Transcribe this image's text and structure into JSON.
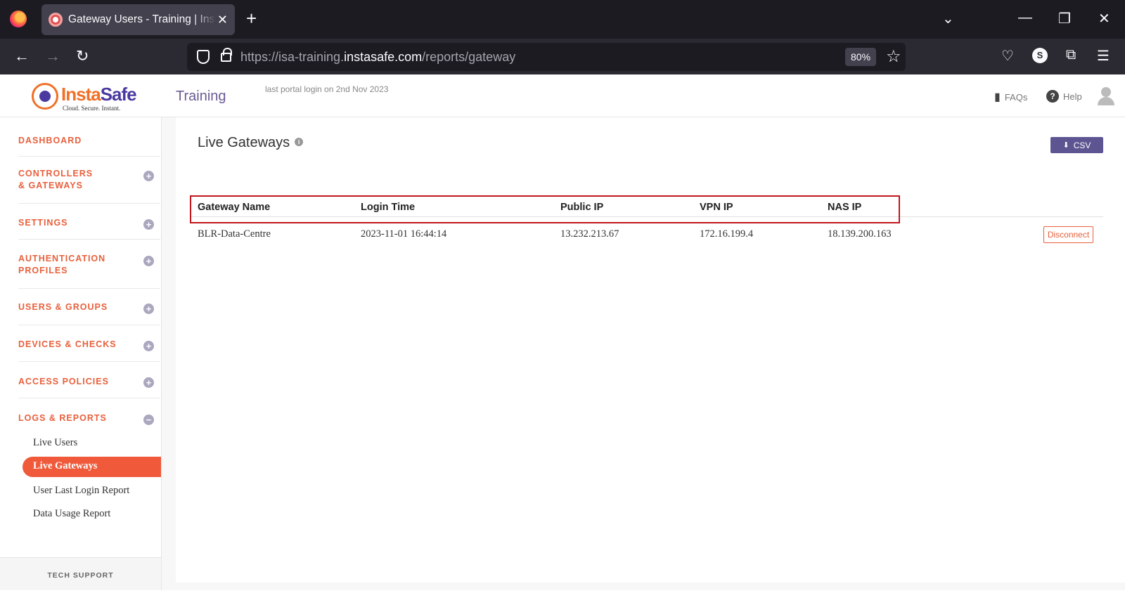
{
  "browser": {
    "tab_title": "Gateway Users - Training | InstaSafe",
    "url_prefix": "https://isa-training.",
    "url_host": "instasafe.com",
    "url_path": "/reports/gateway",
    "zoom": "80%",
    "profile_initial": "S"
  },
  "header": {
    "logo_insta": "Insta",
    "logo_safe": "Safe",
    "logo_tagline": "Cloud. Secure. Instant.",
    "title": "Training",
    "last_login": "last portal login on 2nd Nov 2023",
    "faqs": "FAQs",
    "help": "Help"
  },
  "sidebar": {
    "items": [
      {
        "label": "DASHBOARD"
      },
      {
        "label": "CONTROLLERS & GATEWAYS"
      },
      {
        "label": "SETTINGS"
      },
      {
        "label": "AUTHENTICATION PROFILES"
      },
      {
        "label": "USERS & GROUPS"
      },
      {
        "label": "DEVICES & CHECKS"
      },
      {
        "label": "ACCESS POLICIES"
      },
      {
        "label": "LOGS & REPORTS"
      }
    ],
    "sub_items": [
      {
        "label": "Live Users"
      },
      {
        "label": "Live Gateways"
      },
      {
        "label": "User Last Login Report"
      },
      {
        "label": "Data Usage Report"
      }
    ],
    "tech_support": "TECH SUPPORT"
  },
  "main": {
    "title": "Live Gateways",
    "csv_label": "CSV",
    "columns": [
      "Gateway Name",
      "Login Time",
      "Public IP",
      "VPN IP",
      "NAS IP"
    ],
    "rows": [
      {
        "gateway_name": "BLR-Data-Centre",
        "login_time": "2023-11-01 16:44:14",
        "public_ip": "13.232.213.67",
        "vpn_ip": "172.16.199.4",
        "nas_ip": "18.139.200.163",
        "action": "Disconnect"
      }
    ]
  }
}
